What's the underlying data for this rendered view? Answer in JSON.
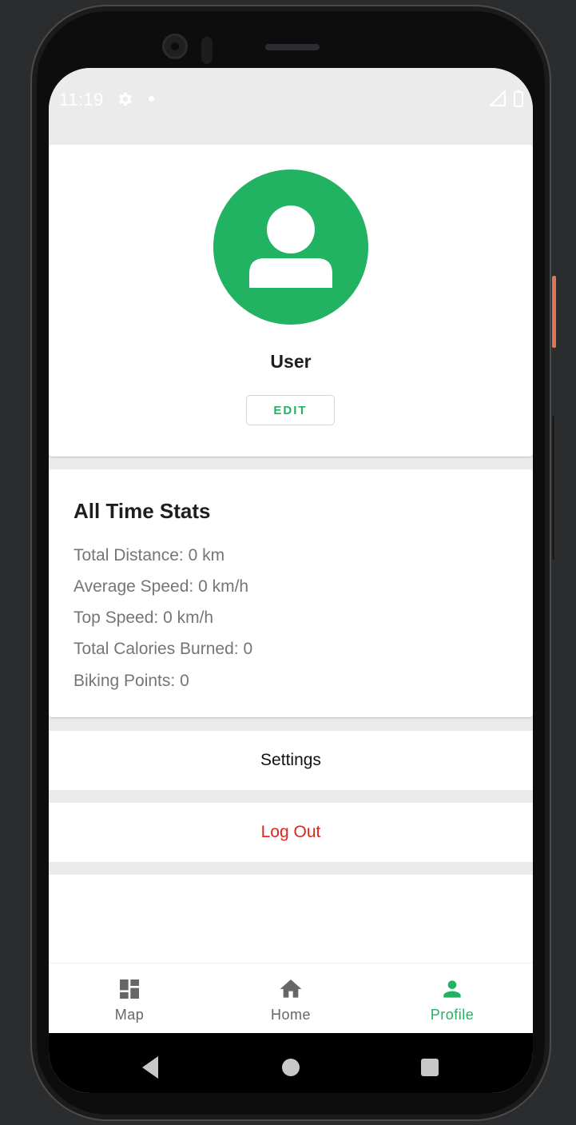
{
  "status_bar": {
    "time": "11:19",
    "settings_icon": "gear-icon",
    "notification_icon": "dot-icon",
    "signal_icon": "signal-icon",
    "battery_icon": "battery-icon"
  },
  "profile": {
    "avatar_icon": "person-icon",
    "username": "User",
    "edit_label": "EDIT"
  },
  "stats": {
    "title": "All Time Stats",
    "lines": [
      "Total Distance: 0 km",
      "Average Speed: 0 km/h",
      "Top Speed: 0 km/h",
      "Total Calories Burned: 0",
      "Biking Points: 0"
    ]
  },
  "actions": {
    "settings_label": "Settings",
    "logout_label": "Log Out"
  },
  "bottom_nav": {
    "items": [
      {
        "label": "Map",
        "icon": "dashboard-icon",
        "active": false
      },
      {
        "label": "Home",
        "icon": "home-icon",
        "active": false
      },
      {
        "label": "Profile",
        "icon": "person-icon",
        "active": true
      }
    ]
  },
  "system_nav": {
    "back_icon": "back-triangle-icon",
    "home_icon": "home-circle-icon",
    "recents_icon": "recents-square-icon"
  },
  "colors": {
    "accent": "#21b362",
    "logout": "#e0241a",
    "background": "#ebebeb"
  }
}
